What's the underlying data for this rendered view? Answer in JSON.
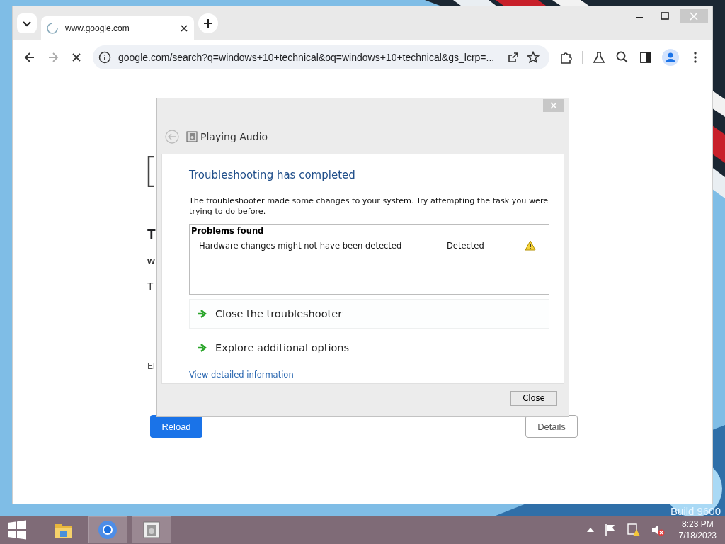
{
  "desktop": {
    "watermark": "Build 9600"
  },
  "browser": {
    "tabs": [
      {
        "title": "www.google.com",
        "loading": true,
        "selected": true
      }
    ],
    "address": "google.com/search?q=windows+10+technical&oq=windows+10+technical&gs_lcrp=...",
    "loading": true
  },
  "page": {
    "heading": "T",
    "subtitle": "w",
    "body": "T",
    "error_code": "El",
    "buttons": [
      {
        "label": "Reload",
        "kind": "primary"
      },
      {
        "label": "Details",
        "kind": "secondary"
      }
    ]
  },
  "dialog": {
    "title": "Playing Audio",
    "heading": "Troubleshooting has completed",
    "message": "The troubleshooter made some changes to your system. Try attempting the task you were trying to do before.",
    "problems": {
      "title": "Problems found",
      "rows": [
        {
          "name": "Hardware changes might not have been detected",
          "status": "Detected"
        }
      ]
    },
    "options": [
      {
        "label": "Close the troubleshooter",
        "hovered": true
      },
      {
        "label": "Explore additional options",
        "hovered": false
      }
    ],
    "link": "View detailed information",
    "button": "Close"
  },
  "taskbar": {
    "apps": [
      {
        "kind": "explorer",
        "open": false
      },
      {
        "kind": "chrome",
        "open": true
      },
      {
        "kind": "troubleshooter",
        "open": true
      }
    ],
    "time": "8:23 PM",
    "date": "7/18/2023"
  }
}
